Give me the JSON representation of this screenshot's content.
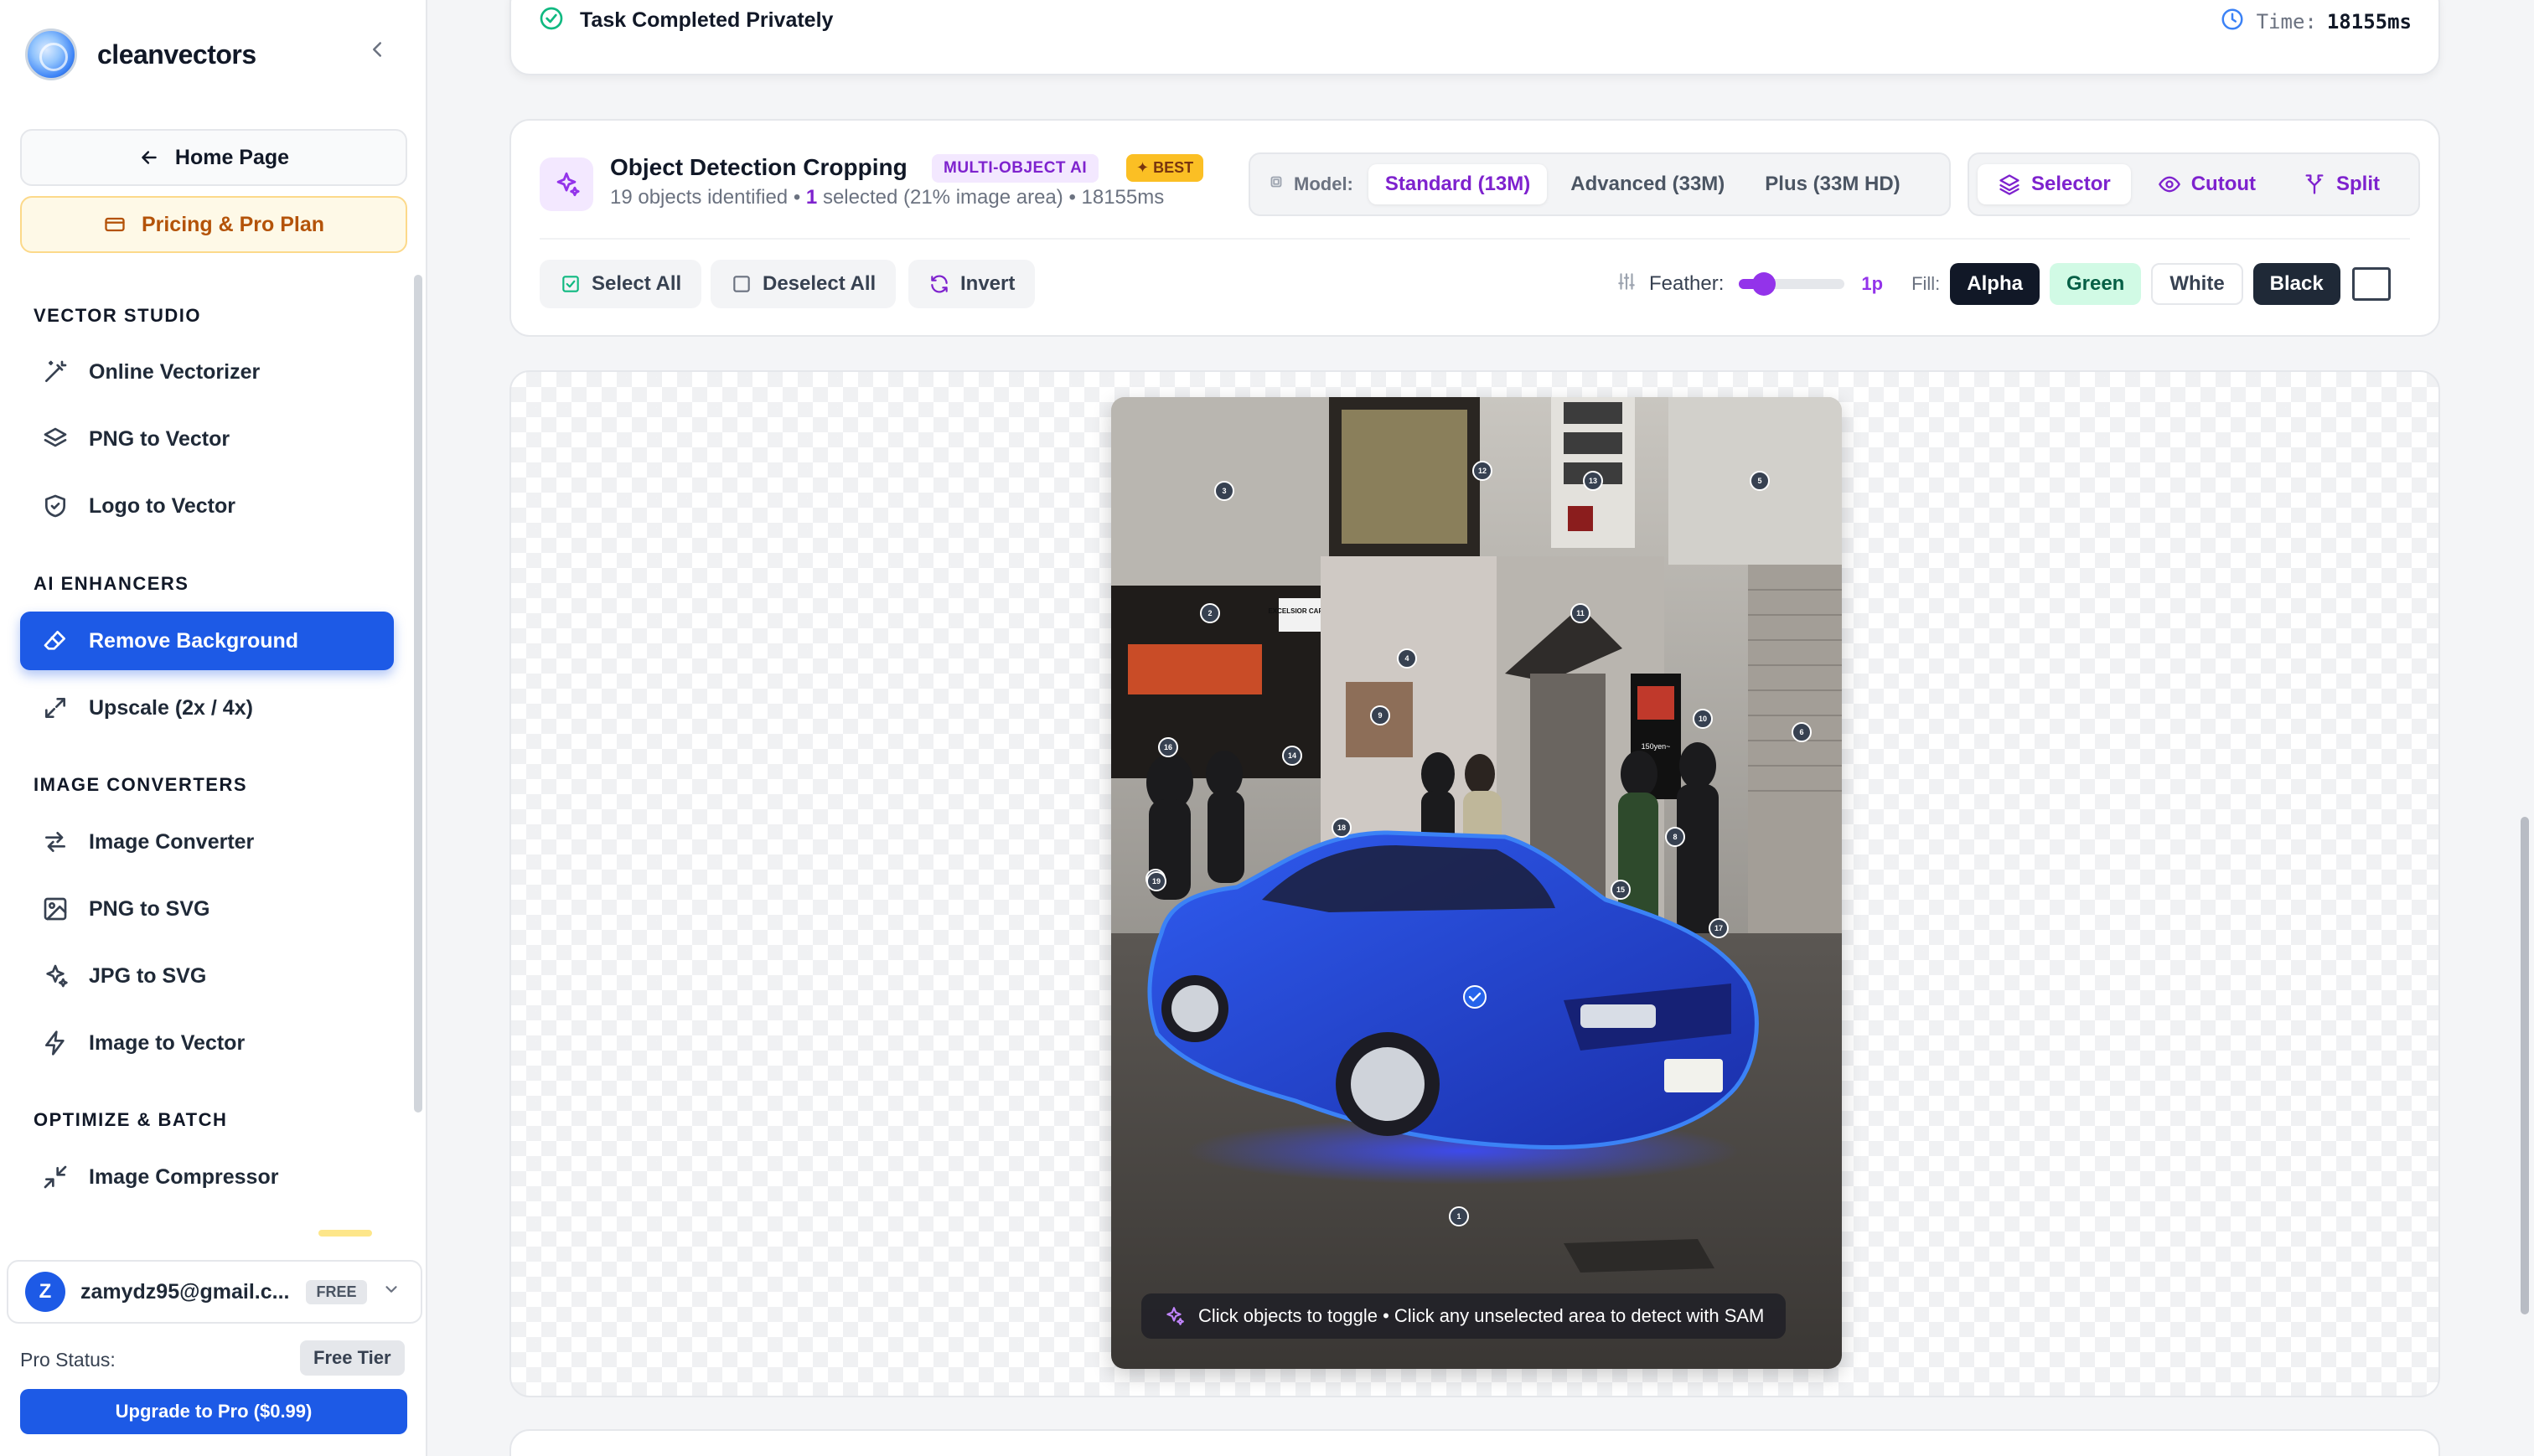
{
  "app": {
    "brand": "cleanvectors"
  },
  "sidebar": {
    "home_label": "Home Page",
    "pricing_label": "Pricing & Pro Plan",
    "sections": [
      {
        "title": "VECTOR STUDIO",
        "items": [
          "Online Vectorizer",
          "PNG to Vector",
          "Logo to Vector"
        ]
      },
      {
        "title": "AI ENHANCERS",
        "items": [
          "Remove Background",
          "Upscale (2x / 4x)"
        ]
      },
      {
        "title": "IMAGE CONVERTERS",
        "items": [
          "Image Converter",
          "PNG to SVG",
          "JPG to SVG",
          "Image to Vector"
        ]
      },
      {
        "title": "OPTIMIZE & BATCH",
        "items": [
          "Image Compressor"
        ]
      }
    ],
    "active_item": "Remove Background",
    "user": {
      "initial": "Z",
      "email": "zamydz95@gmail.c...",
      "plan_badge": "FREE"
    },
    "pro_status_label": "Pro Status:",
    "pro_status_value": "Free Tier",
    "upgrade_label": "Upgrade to Pro ($0.99)"
  },
  "status": {
    "text": "Task Completed Privately",
    "time_label": "Time:",
    "time_value": "18155ms"
  },
  "tool": {
    "title": "Object Detection Cropping",
    "badge_ai": "MULTI-OBJECT AI",
    "badge_best": "BEST",
    "objects_text": "19 objects identified",
    "sep1": "•",
    "selected_count": "1",
    "selected_text": "selected (21% image area)",
    "sep2": "•",
    "time_text": "18155ms",
    "model_label": "Model:",
    "models": [
      "Standard (13M)",
      "Advanced (33M)",
      "Plus (33M HD)"
    ],
    "active_model": "Standard (13M)",
    "modes": [
      "Selector",
      "Cutout",
      "Split"
    ],
    "active_mode": "Selector",
    "select_all": "Select All",
    "deselect_all": "Deselect All",
    "invert": "Invert",
    "feather_label": "Feather:",
    "feather_value": "1p",
    "feather_level": 0.2,
    "fill_label": "Fill:",
    "fills": [
      "Alpha",
      "Green",
      "White",
      "Black"
    ],
    "active_fill": "Alpha"
  },
  "canvas": {
    "hint": "Click objects to toggle • Click any unselected area to detect with SAM",
    "markers": [
      "1",
      "2",
      "3",
      "4",
      "5",
      "6",
      "7",
      "8",
      "9",
      "10",
      "11",
      "12",
      "13",
      "14",
      "15",
      "16",
      "17",
      "18",
      "19"
    ],
    "signs": [
      "EXCELSIOR CAFFE",
      "150yen~"
    ]
  },
  "colors": {
    "accent_blue": "#1d5ae6",
    "accent_purple": "#7e22ce",
    "selection_blue": "#2563eb"
  }
}
